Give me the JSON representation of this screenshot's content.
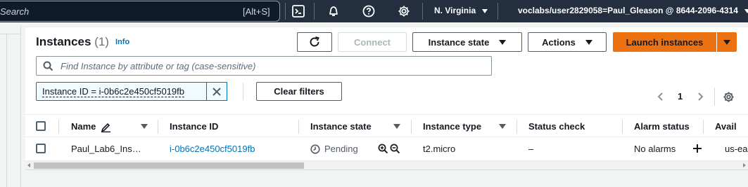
{
  "topnav": {
    "search_placeholder": "Search",
    "search_shortcut": "[Alt+S]",
    "region": "N. Virginia",
    "account": "voclabs/user2829058=Paul_Gleason @ 8644-2096-4314"
  },
  "instances": {
    "title": "Instances",
    "count": "(1)",
    "info_link": "Info",
    "buttons": {
      "connect": "Connect",
      "instance_state": "Instance state",
      "actions": "Actions",
      "launch": "Launch instances"
    },
    "find_placeholder": "Find Instance by attribute or tag (case-sensitive)",
    "filter_token": "Instance ID = i-0b6c2e450cf5019fb",
    "clear_filters": "Clear filters",
    "page_number": "1"
  },
  "table": {
    "headers": {
      "name": "Name",
      "instance_id": "Instance ID",
      "instance_state": "Instance state",
      "instance_type": "Instance type",
      "status_check": "Status check",
      "alarm_status": "Alarm status",
      "availability_zone": "Avail"
    },
    "rows": [
      {
        "name": "Paul_Lab6_Ins…",
        "instance_id": "i-0b6c2e450cf5019fb",
        "instance_state": "Pending",
        "instance_type": "t2.micro",
        "status_check": "–",
        "alarm_status": "No alarms",
        "availability_zone": "us-ea"
      }
    ]
  },
  "colors": {
    "topbar": "#232f3e",
    "primary": "#ec7211",
    "link": "#0073bb"
  }
}
